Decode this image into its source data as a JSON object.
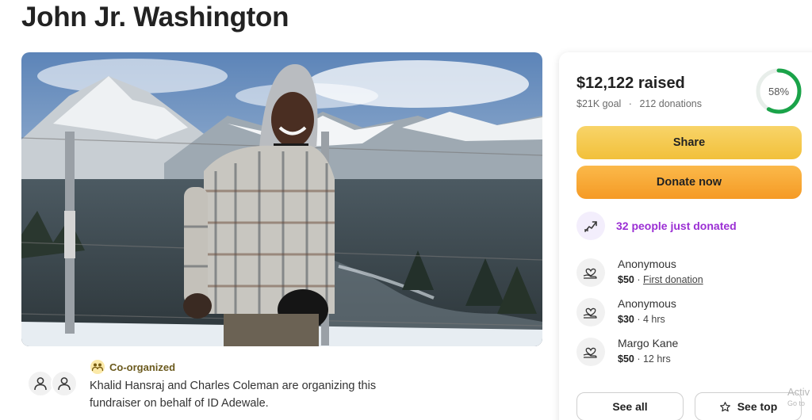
{
  "page": {
    "title": "John Jr. Washington"
  },
  "hero": {
    "icon": "hero-photo"
  },
  "organizers": {
    "badge_label": "Co-organized",
    "description": "Khalid Hansraj and Charles Coleman are organizing this fundraiser on behalf of ID Adewale."
  },
  "donation_card": {
    "raised": "$12,122 raised",
    "goal": "$21K goal",
    "separator": "·",
    "donations": "212 donations",
    "progress_label": "58%",
    "progress_fraction": 0.58,
    "share_label": "Share",
    "donate_label": "Donate now",
    "recent_activity": "32 people just donated",
    "donors": [
      {
        "name": "Anonymous",
        "amount": "$50",
        "sep": " · ",
        "detail": "First donation",
        "detail_is_link": true
      },
      {
        "name": "Anonymous",
        "amount": "$30",
        "sep": " · ",
        "detail": "4 hrs",
        "detail_is_link": false
      },
      {
        "name": "Margo Kane",
        "amount": "$50",
        "sep": " · ",
        "detail": "12 hrs",
        "detail_is_link": false
      }
    ],
    "see_all_label": "See all",
    "see_top_label": "See top"
  },
  "watermark": {
    "line1": "Activ",
    "line2": "Go to"
  },
  "colors": {
    "share_button": "#f2c03a",
    "donate_button": "#f59a25",
    "progress": "#1aa349",
    "activity_text": "#9b2fd4"
  }
}
